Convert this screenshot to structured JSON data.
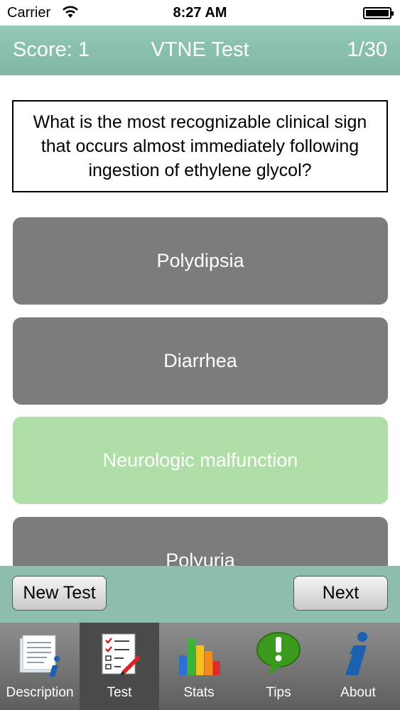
{
  "status_bar": {
    "carrier": "Carrier",
    "time": "8:27 AM"
  },
  "header": {
    "score": "Score: 1",
    "title": "VTNE Test",
    "counter": "1/30"
  },
  "question": {
    "text": "What is the most recognizable clinical sign that occurs almost immediately following ingestion of ethylene glycol?"
  },
  "answers": [
    {
      "label": "Polydipsia",
      "state": "default"
    },
    {
      "label": "Diarrhea",
      "state": "default"
    },
    {
      "label": "Neurologic malfunction",
      "state": "correct"
    },
    {
      "label": "Polyuria",
      "state": "default"
    }
  ],
  "buttons": {
    "new_test": "New Test",
    "next": "Next"
  },
  "tabs": [
    {
      "label": "Description",
      "icon": "description-icon",
      "selected": false
    },
    {
      "label": "Test",
      "icon": "checklist-icon",
      "selected": true
    },
    {
      "label": "Stats",
      "icon": "bar-chart-icon",
      "selected": false
    },
    {
      "label": "Tips",
      "icon": "exclamation-bubble-icon",
      "selected": false
    },
    {
      "label": "About",
      "icon": "info-icon",
      "selected": false
    }
  ],
  "colors": {
    "header": "#8ebfae",
    "answer_default": "#7d7c7d",
    "answer_correct": "#afdea6"
  }
}
